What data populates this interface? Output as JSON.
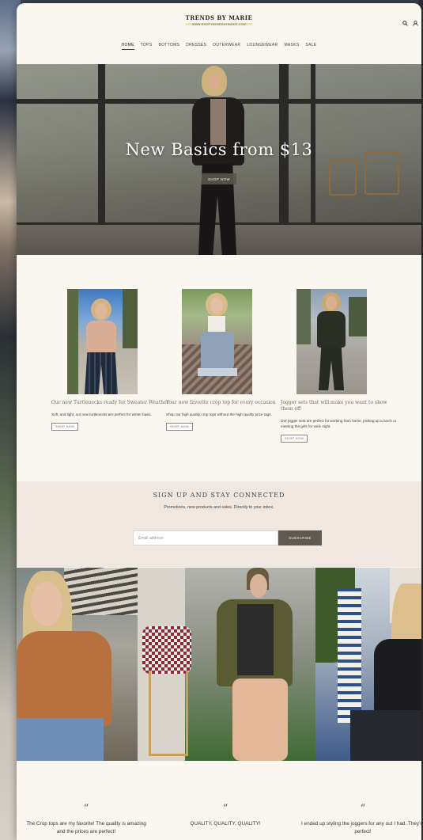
{
  "header": {
    "logo_title": "TRENDS BY MARIE",
    "logo_url": "WWW.SHOPTRENDSBYMARIE.COM",
    "icons": [
      "search-icon",
      "user-icon"
    ]
  },
  "nav": {
    "items": [
      {
        "label": "HOME",
        "active": true
      },
      {
        "label": "TOPS"
      },
      {
        "label": "BOTTOMS"
      },
      {
        "label": "DRESSES"
      },
      {
        "label": "OUTERWEAR"
      },
      {
        "label": "LOUNGEWEAR"
      },
      {
        "label": "MASKS"
      },
      {
        "label": "SALE"
      }
    ]
  },
  "hero": {
    "title": "New Basics from $13",
    "button": "SHOP NOW"
  },
  "products": [
    {
      "title": "Our new Turtlenecks ready for Sweater Weather",
      "desc": "Soft, and light, our new turtlenecks are perfect for winter basic.",
      "button": "SHOP NOW"
    },
    {
      "title": "Your new favorite crop top for every occasion",
      "desc": "Shop our high quality crop tops without the high quality price tags.",
      "button": "SHOP NOW"
    },
    {
      "title": "Jogger sets that will make you want to show them off",
      "desc": "Our jogger sets are perfect for working from home, picking up a lunch or meeting the girls for wine night.",
      "button": "SHOP NOW"
    }
  ],
  "signup": {
    "title": "SIGN UP AND STAY CONNECTED",
    "subtitle": "Promotions, new products and sales. Directly to your inbox.",
    "placeholder": "Email address",
    "button": "SUBSCRIBE"
  },
  "testimonials": [
    {
      "quote_mark": "“",
      "text": "The Crop tops are my favorite! The quality is amazing and the prices are perfect!"
    },
    {
      "quote_mark": "“",
      "text": "QUALITY, QUALITY, QUALITY!"
    },
    {
      "quote_mark": "“",
      "text": "I ended up styling the joggers for any out I had. They're perfect!"
    }
  ],
  "colors": {
    "page_bg": "#faf6f0",
    "signup_bg": "#f0e8e0",
    "button_dark": "#5f5a50",
    "accent_underline": "#f2e4a0"
  }
}
